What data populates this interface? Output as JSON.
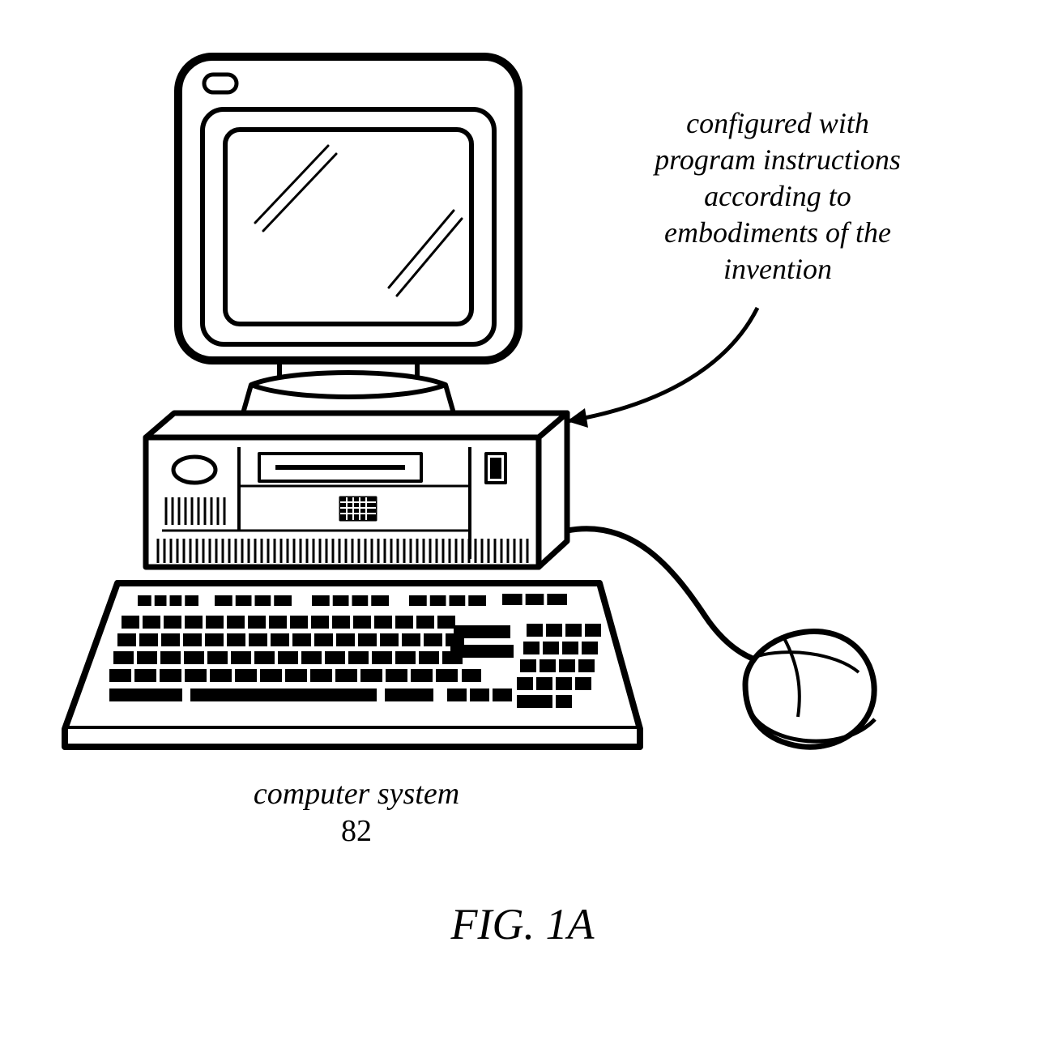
{
  "callout": {
    "line1": "configured with",
    "line2": "program instructions",
    "line3": "according to",
    "line4": "embodiments of the",
    "line5": "invention"
  },
  "bottom_label": "computer system",
  "reference_number": "82",
  "figure_caption": "FIG. 1A"
}
